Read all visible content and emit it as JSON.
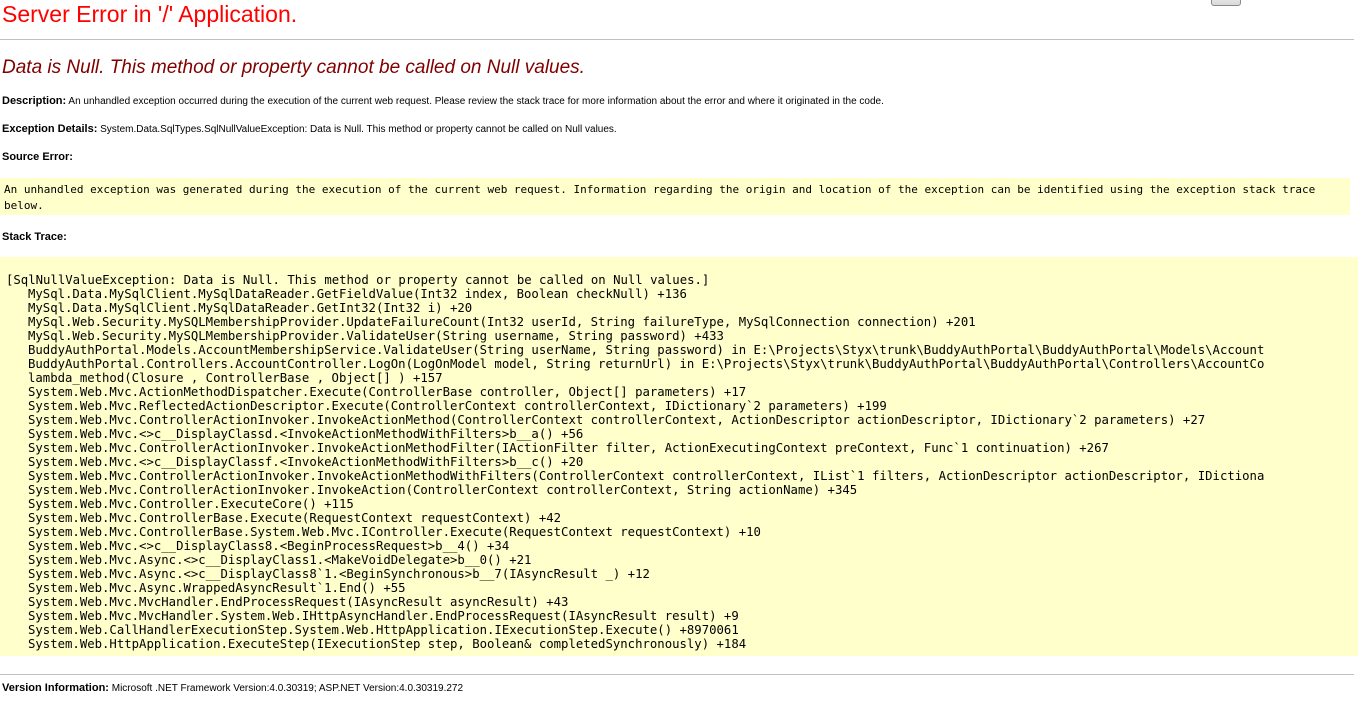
{
  "page": {
    "title": "Server Error in '/' Application.",
    "error_heading": "Data is Null. This method or property cannot be called on Null values.",
    "description_label": "Description:",
    "description_text": "An unhandled exception occurred during the execution of the current web request. Please review the stack trace for more information about the error and where it originated in the code.",
    "exception_label": "Exception Details:",
    "exception_text": "System.Data.SqlTypes.SqlNullValueException: Data is Null. This method or property cannot be called on Null values.",
    "source_error_label": "Source Error:",
    "source_error_text": "An unhandled exception was generated during the execution of the current web request. Information regarding the origin and location of the exception can be identified using the exception stack trace below.",
    "stack_trace_label": "Stack Trace:",
    "stack_trace_header": "[SqlNullValueException: Data is Null. This method or property cannot be called on Null values.]",
    "stack_trace_lines": [
      "MySql.Data.MySqlClient.MySqlDataReader.GetFieldValue(Int32 index, Boolean checkNull) +136",
      "MySql.Data.MySqlClient.MySqlDataReader.GetInt32(Int32 i) +20",
      "MySql.Web.Security.MySQLMembershipProvider.UpdateFailureCount(Int32 userId, String failureType, MySqlConnection connection) +201",
      "MySql.Web.Security.MySQLMembershipProvider.ValidateUser(String username, String password) +433",
      "BuddyAuthPortal.Models.AccountMembershipService.ValidateUser(String userName, String password) in E:\\Projects\\Styx\\trunk\\BuddyAuthPortal\\BuddyAuthPortal\\Models\\Account",
      "BuddyAuthPortal.Controllers.AccountController.LogOn(LogOnModel model, String returnUrl) in E:\\Projects\\Styx\\trunk\\BuddyAuthPortal\\BuddyAuthPortal\\Controllers\\AccountCo",
      "lambda_method(Closure , ControllerBase , Object[] ) +157",
      "System.Web.Mvc.ActionMethodDispatcher.Execute(ControllerBase controller, Object[] parameters) +17",
      "System.Web.Mvc.ReflectedActionDescriptor.Execute(ControllerContext controllerContext, IDictionary`2 parameters) +199",
      "System.Web.Mvc.ControllerActionInvoker.InvokeActionMethod(ControllerContext controllerContext, ActionDescriptor actionDescriptor, IDictionary`2 parameters) +27",
      "System.Web.Mvc.<>c__DisplayClassd.<InvokeActionMethodWithFilters>b__a() +56",
      "System.Web.Mvc.ControllerActionInvoker.InvokeActionMethodFilter(IActionFilter filter, ActionExecutingContext preContext, Func`1 continuation) +267",
      "System.Web.Mvc.<>c__DisplayClassf.<InvokeActionMethodWithFilters>b__c() +20",
      "System.Web.Mvc.ControllerActionInvoker.InvokeActionMethodWithFilters(ControllerContext controllerContext, IList`1 filters, ActionDescriptor actionDescriptor, IDictiona",
      "System.Web.Mvc.ControllerActionInvoker.InvokeAction(ControllerContext controllerContext, String actionName) +345",
      "System.Web.Mvc.Controller.ExecuteCore() +115",
      "System.Web.Mvc.ControllerBase.Execute(RequestContext requestContext) +42",
      "System.Web.Mvc.ControllerBase.System.Web.Mvc.IController.Execute(RequestContext requestContext) +10",
      "System.Web.Mvc.<>c__DisplayClass8.<BeginProcessRequest>b__4() +34",
      "System.Web.Mvc.Async.<>c__DisplayClass1.<MakeVoidDelegate>b__0() +21",
      "System.Web.Mvc.Async.<>c__DisplayClass8`1.<BeginSynchronous>b__7(IAsyncResult _) +12",
      "System.Web.Mvc.Async.WrappedAsyncResult`1.End() +55",
      "System.Web.Mvc.MvcHandler.EndProcessRequest(IAsyncResult asyncResult) +43",
      "System.Web.Mvc.MvcHandler.System.Web.IHttpAsyncHandler.EndProcessRequest(IAsyncResult result) +9",
      "System.Web.CallHandlerExecutionStep.System.Web.HttpApplication.IExecutionStep.Execute() +8970061",
      "System.Web.HttpApplication.ExecuteStep(IExecutionStep step, Boolean& completedSynchronously) +184"
    ],
    "version_label": "Version Information:",
    "version_text": "Microsoft .NET Framework Version:4.0.30319; ASP.NET Version:4.0.30319.272"
  },
  "colors": {
    "title": "#ff0000",
    "error_heading": "#800000",
    "code_background": "#ffffcc"
  }
}
